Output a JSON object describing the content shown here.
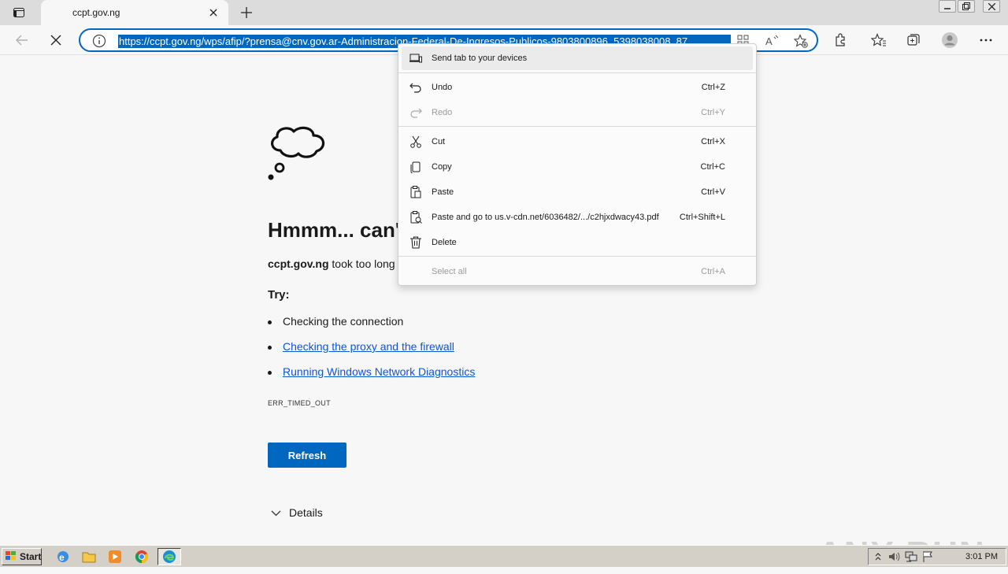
{
  "tab": {
    "title": "ccpt.gov.ng"
  },
  "toolbar": {
    "url": "https://ccpt.gov.ng/wps/afip/?prensa@cnv.gov.ar-Administracion-Federal-De-Ingresos-Publicos-9803800896_5398038008_87"
  },
  "page": {
    "headline": "Hmmm... can'",
    "desc_site": "ccpt.gov.ng",
    "desc_rest": " took too long",
    "try_label": "Try:",
    "tips": [
      "Checking the connection",
      "Checking the proxy and the firewall",
      "Running Windows Network Diagnostics"
    ],
    "error_code": "ERR_TIMED_OUT",
    "refresh_label": "Refresh",
    "details_label": "Details"
  },
  "context_menu": {
    "send_tab": "Send tab to your devices",
    "undo": {
      "label": "Undo",
      "shortcut": "Ctrl+Z"
    },
    "redo": {
      "label": "Redo",
      "shortcut": "Ctrl+Y"
    },
    "cut": {
      "label": "Cut",
      "shortcut": "Ctrl+X"
    },
    "copy": {
      "label": "Copy",
      "shortcut": "Ctrl+C"
    },
    "paste": {
      "label": "Paste",
      "shortcut": "Ctrl+V"
    },
    "paste_go": {
      "label": "Paste and go to us.v-cdn.net/6036482/.../c2hjxdwacy43.pdf",
      "shortcut": "Ctrl+Shift+L"
    },
    "delete": {
      "label": "Delete"
    },
    "select_all": {
      "label": "Select all",
      "shortcut": "Ctrl+A"
    }
  },
  "taskbar": {
    "start_label": "Start",
    "clock": "3:01 PM"
  },
  "watermark": "ANY RUN",
  "colors": {
    "accent": "#0067c0",
    "link": "#0b57d0",
    "taskbar": "#d4d0c8"
  }
}
